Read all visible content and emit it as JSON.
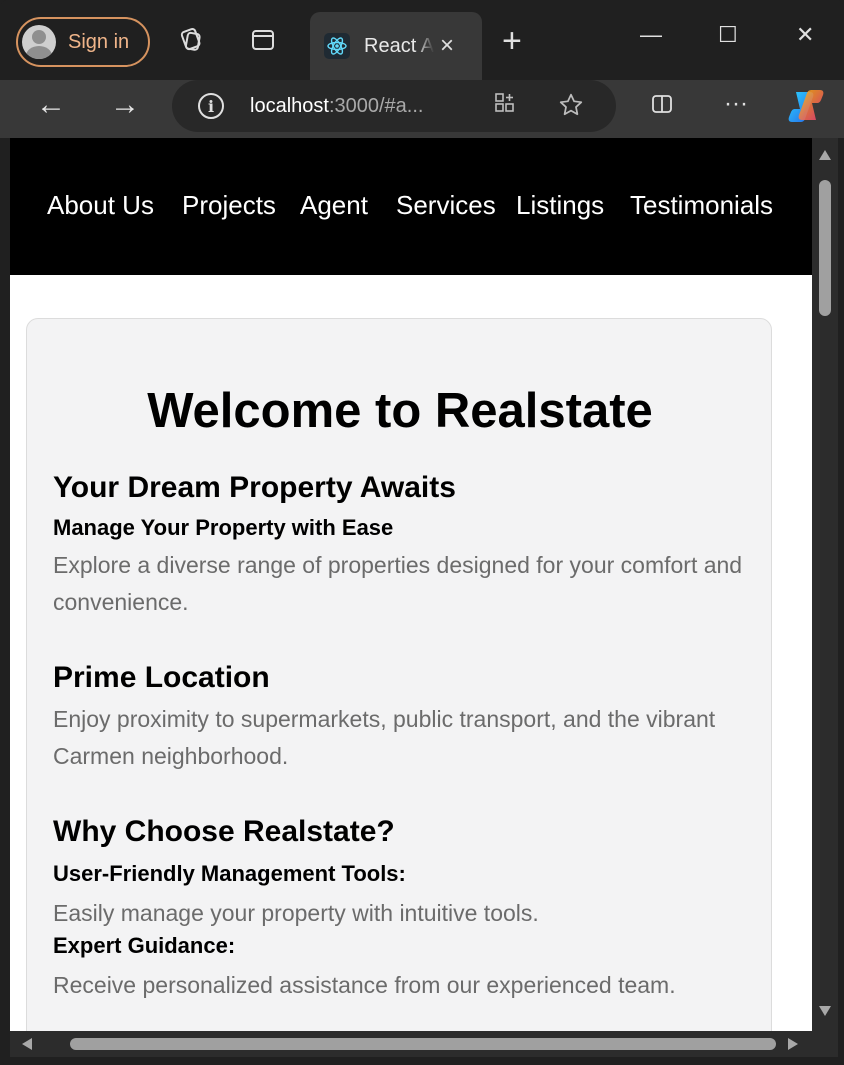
{
  "browser": {
    "sign_in_label": "Sign in",
    "tab_title": "React App",
    "tab_close": "×",
    "new_tab": "+",
    "minimize": "—",
    "maximize": "☐",
    "close": "✕",
    "url_host": "localhost",
    "url_rest": ":3000/#a...",
    "more": "···",
    "back": "←",
    "forward": "→"
  },
  "nav": {
    "items": [
      "About Us",
      "Projects",
      "Agent",
      "Services",
      "Listings",
      "Testimonials"
    ]
  },
  "hero": {
    "title": "Welcome to Realstate",
    "section1_title": "Your Dream Property Awaits",
    "section1_subtitle": "Manage Your Property with Ease",
    "section1_text": "Explore a diverse range of properties designed for your comfort and convenience.",
    "section2_title": "Prime Location",
    "section2_text": "Enjoy proximity to supermarkets, public transport, and the vibrant Carmen neighborhood.",
    "section3_title": "Why Choose Realstate?",
    "feature1_title": "User-Friendly Management Tools:",
    "feature1_text": "Easily manage your property with intuitive tools.",
    "feature2_title": "Expert Guidance:",
    "feature2_text": "Receive personalized assistance from our experienced team."
  },
  "colors": {
    "nav_background": "#000000",
    "card_background": "#f3f3f4",
    "body_text": "#6b6b6b",
    "sign_in_accent": "#d6935f"
  }
}
